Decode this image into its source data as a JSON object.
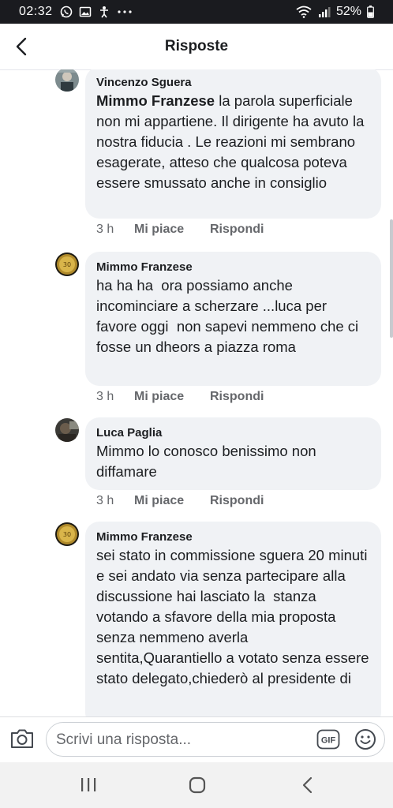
{
  "status": {
    "time": "02:32",
    "battery": "52%"
  },
  "header": {
    "title": "Risposte"
  },
  "comments": [
    {
      "author": "Vincenzo Sguera",
      "mention": "Mimmo Franzese",
      "text": " la parola superficiale non mi appartiene. Il dirigente ha avuto la nostra fiducia . Le reazioni mi sembrano esagerate, atteso che qualcosa poteva essere smussato anche in consiglio",
      "time": "3 h",
      "like": "Mi piace",
      "reply": "Rispondi"
    },
    {
      "author": "Mimmo Franzese",
      "text": "ha ha ha  ora possiamo anche incominciare a scherzare ...luca per favore oggi  non sapevi nemmeno che ci fosse un dheors a piazza roma",
      "time": "3 h",
      "like": "Mi piace",
      "reply": "Rispondi"
    },
    {
      "author": "Luca Paglia",
      "text": "Mimmo lo conosco benissimo non diffamare",
      "time": "3 h",
      "like": "Mi piace",
      "reply": "Rispondi"
    },
    {
      "author": "Mimmo Franzese",
      "text": "sei stato in commissione sguera 20 minuti e sei andato via senza partecipare alla discussione hai lasciato la  stanza votando a sfavore della mia proposta senza nemmeno averla sentita,Quarantiello a votato senza essere stato delegato,chiederò al presidente di",
      "time": "",
      "like": "",
      "reply": ""
    }
  ],
  "composer": {
    "placeholder": "Scrivi una risposta...",
    "gif_label": "GIF"
  },
  "colors": {
    "bubble": "#f0f2f5",
    "meta": "#65676b",
    "statusbar": "#1a1b1f"
  }
}
